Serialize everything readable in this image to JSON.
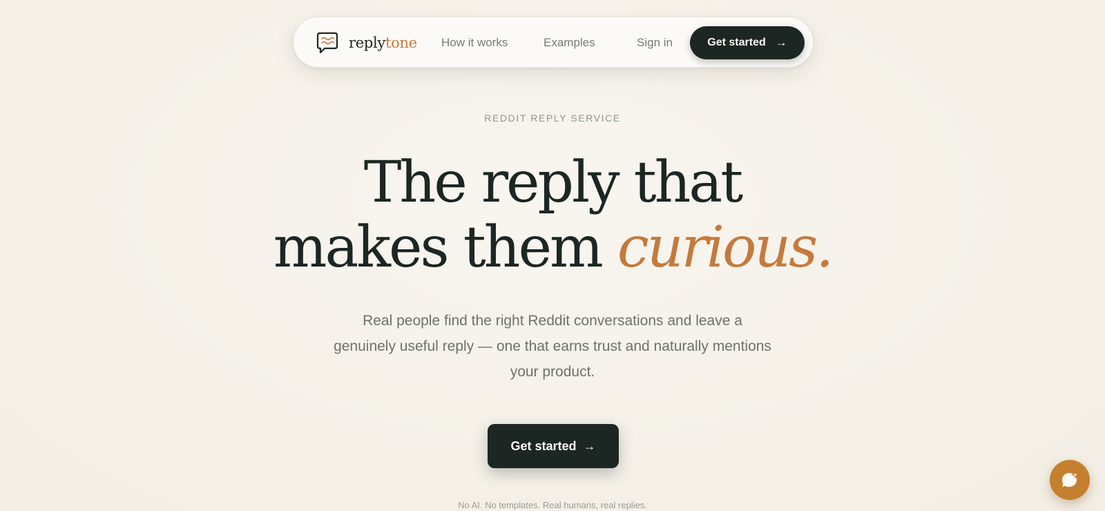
{
  "nav": {
    "logo_text_main": "reply",
    "logo_text_accent": "tone",
    "links": [
      "How it works",
      "Examples"
    ],
    "signin_label": "Sign in",
    "cta_label": "Get started",
    "cta_arrow": "→"
  },
  "hero": {
    "eyebrow": "REDDIT REPLY SERVICE",
    "headline_line1": "The reply that",
    "headline_line2_start": "makes them ",
    "headline_accent": "curious.",
    "subtext": "Real people find the right Reddit conversations and leave a genuinely useful reply — one that earns trust and naturally mentions your product.",
    "cta_label": "Get started",
    "cta_arrow": "→",
    "footnote": "No AI. No templates. Real humans, real replies."
  },
  "icons": {
    "logo": "speech-bubble-waves-icon",
    "chat": "chat-sparkle-icon"
  },
  "colors": {
    "background": "#f6f2ea",
    "ink": "#1c2622",
    "accent": "#c47a3c",
    "chat_button": "#c4802e"
  }
}
